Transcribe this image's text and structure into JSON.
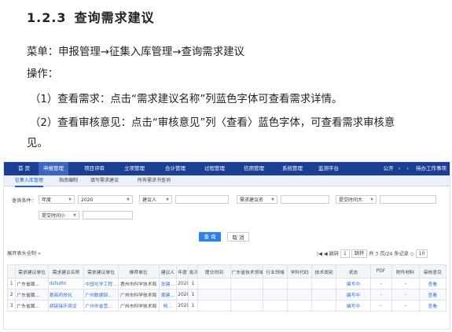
{
  "section": {
    "number": "1.2.3",
    "title": "查询需求建议"
  },
  "paragraphs": {
    "menu": "菜单：申报管理→征集入库管理→查询需求建议",
    "operation": "操作：",
    "step1": "（1）查看需求：点击“需求建议名称”列蓝色字体可查看需求详情。",
    "step2_line1": "（2）查看审核意见：点击“审核意见”列〈查看〉蓝色字体，可查看需求审核意",
    "step2_line2": "见。"
  },
  "screenshot": {
    "topnav": [
      {
        "label": "首 页"
      },
      {
        "label": "申报管理"
      },
      {
        "label": "项目评审"
      },
      {
        "label": "立项管理"
      },
      {
        "label": "合计管理"
      },
      {
        "label": "过程管理"
      },
      {
        "label": "信用管理"
      },
      {
        "label": "系统管理"
      },
      {
        "label": "监测平台"
      }
    ],
    "topright": {
      "announce": "公开",
      "arrows": "‹ ›",
      "work": "待办工作事项"
    },
    "tabs": [
      {
        "label": "征集入库管理"
      },
      {
        "label": "指南编制"
      },
      {
        "label": "填写需求建议"
      },
      {
        "label": "所有需求书查询"
      }
    ],
    "filters": {
      "conditions_label": "查询条件：",
      "year_label": "年度",
      "year_value": "2020",
      "contact_label": "建议人",
      "name_label": "需求建议名",
      "submit_time_label": "提交时间大",
      "submit_time_small_label": "提交时间小"
    },
    "buttons": {
      "query": "查 询",
      "reset": "取 消"
    },
    "pager": {
      "left": "展开表头全制 »",
      "goto_label": "跳转",
      "page_value": "1",
      "goto_button": "跳转",
      "summary": "共 3 页/24 条记录 ◇",
      "page_size": "10"
    },
    "columns": [
      "需求建议单位",
      "需求建议名称",
      "需求建议单位",
      "推荐单位",
      "建议人",
      "年度",
      "批次",
      "提交时间",
      "广东省技术领域",
      "行业领域",
      "学科代码",
      "技术类别",
      "状态",
      "PDF",
      "附件材料",
      "审核意见"
    ],
    "rows": [
      [
        "广东省属…",
        "dsfsdfd",
        "中国化学工程…",
        "惠州市科学技术局",
        "张键…",
        "2020",
        "1",
        "",
        "",
        "",
        "",
        "",
        "编写中",
        "-",
        "-",
        "查看"
      ],
      [
        "广东省属…",
        "黄商药效化",
        "广州数据部…",
        "广州市科学技术局",
        "黄建…",
        "2020",
        "1",
        "",
        "",
        "",
        "",
        "",
        "编写中",
        "-",
        "-",
        "查看"
      ],
      [
        "广东省属…",
        "病链接环境设",
        "广州市省营…",
        "广州市科学技术局",
        "杨…",
        "2020",
        "1",
        "",
        "",
        "",
        "",
        "",
        "编写中",
        "-",
        "-",
        "查看"
      ]
    ],
    "row_numbers": [
      "1",
      "2",
      "3"
    ]
  }
}
